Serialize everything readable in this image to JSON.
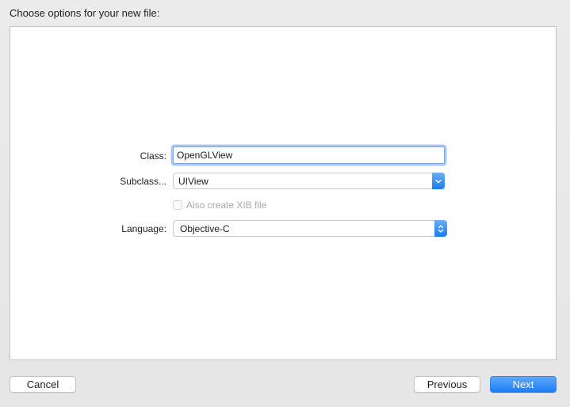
{
  "dialog": {
    "title": "Choose options for your new file:"
  },
  "form": {
    "class_label": "Class:",
    "class_value": "OpenGLView",
    "subclass_label": "Subclass...",
    "subclass_value": "UIView",
    "xib_label": "Also create XIB file",
    "xib_checked": false,
    "xib_enabled": false,
    "language_label": "Language:",
    "language_value": "Objective-C"
  },
  "buttons": {
    "cancel": "Cancel",
    "previous": "Previous",
    "next": "Next"
  },
  "colors": {
    "accent": "#1b7ef4",
    "panel_bg": "#ffffff",
    "window_bg": "#e8e8e8"
  },
  "icons": {
    "subclass_popup": "chevron-down-icon",
    "language_popup": "up-down-chevron-icon"
  }
}
